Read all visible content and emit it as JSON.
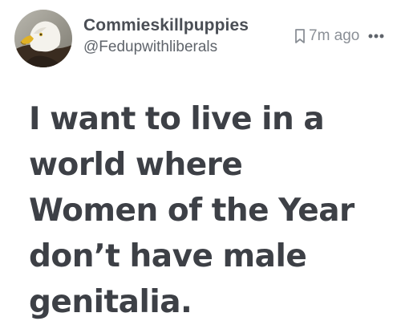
{
  "post": {
    "author": {
      "display_name": "Commieskillpuppies",
      "handle": "@Fedupwithliberals",
      "avatar_icon": "bald-eagle-avatar"
    },
    "meta": {
      "bookmark_icon": "bookmark-icon",
      "timestamp": "7m ago",
      "more_icon": "more-horizontal-icon"
    },
    "text": "I want to live in a\nworld where\nWomen of the Year\ndon’t have male\ngenitalia."
  },
  "colors": {
    "text": "#3d4046",
    "name": "#4a4e55",
    "handle": "#5f646b",
    "meta": "#8a8f96",
    "background": "#ffffff"
  }
}
